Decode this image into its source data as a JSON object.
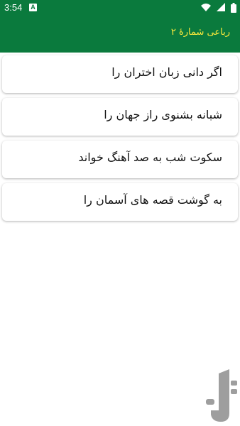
{
  "status_bar": {
    "time": "3:54",
    "notification_icon": "a-icon",
    "icons": [
      "wifi-icon",
      "signal-icon",
      "battery-icon"
    ]
  },
  "app_bar": {
    "title": "رباعی شمارهٔ ۲",
    "background_color": "#0a7a3d",
    "title_color": "#ffeb3b"
  },
  "verses": [
    {
      "text": "اگر دانی زبان اختران را"
    },
    {
      "text": "شبانه بشنوی راز جهان را"
    },
    {
      "text": "سکوت شب به صد آهنگ خواند"
    },
    {
      "text": "به گوشت قصه های آسمان را"
    }
  ],
  "watermark": {
    "icon": "app-logo-icon",
    "color": "#9e9e9e"
  }
}
